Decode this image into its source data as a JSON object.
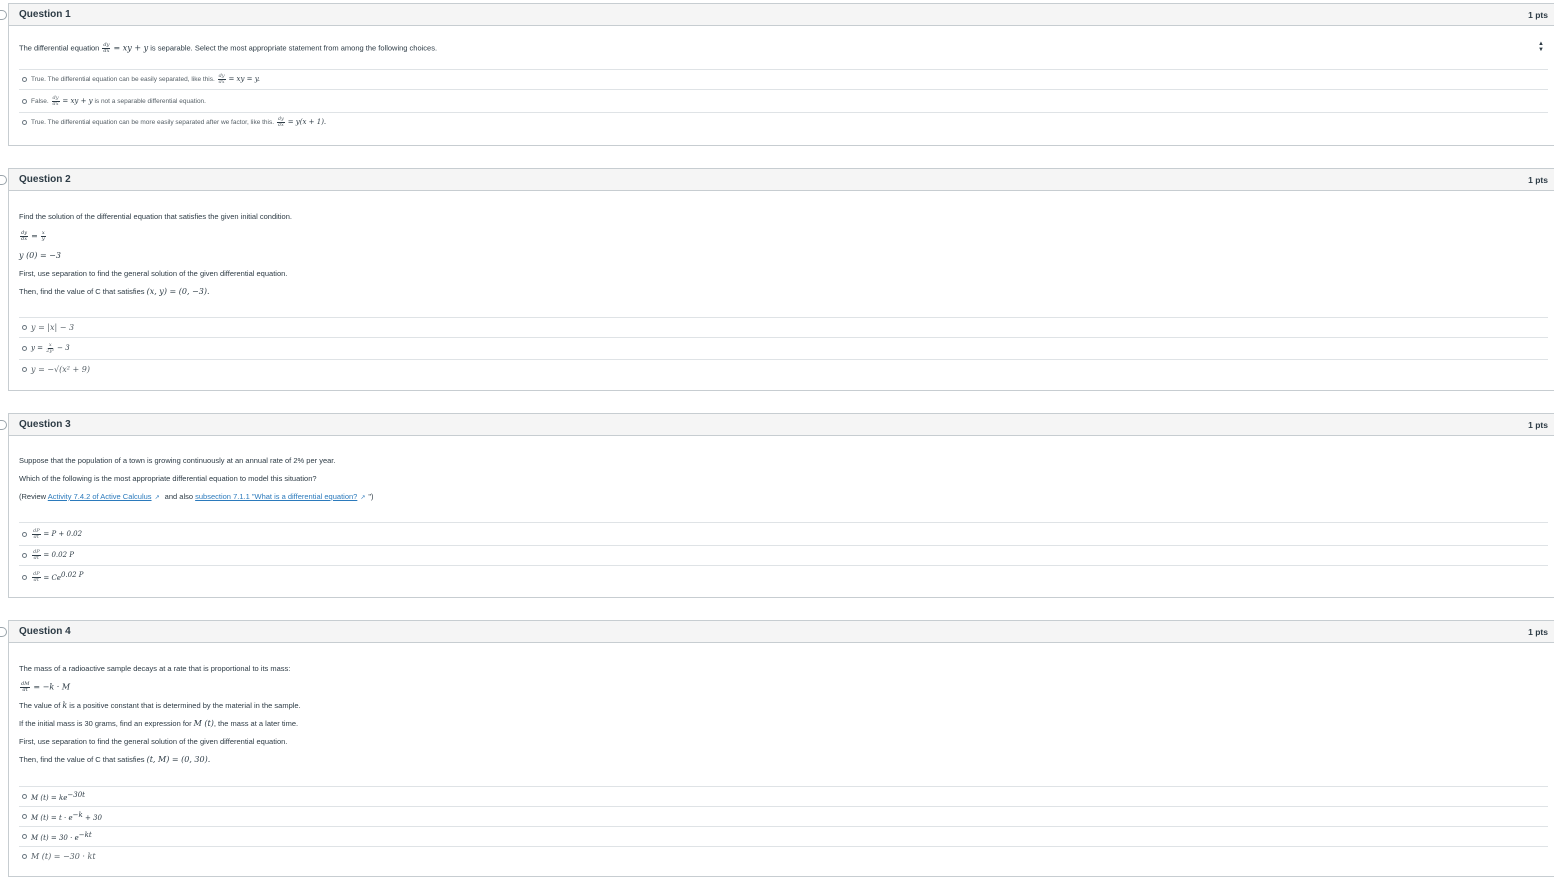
{
  "questions": [
    {
      "title": "Question 1",
      "points": "1 pts",
      "text_before": "The differential equation ",
      "eq_num": "dy",
      "eq_den": "dx",
      "eq_rhs": "= xy + y",
      "text_after": " is separable. Select the most appropriate statement from among the following choices.",
      "answers": [
        {
          "prefix": "True. The differential equation can be easily separated, like this. ",
          "num": "dy",
          "den": "dx",
          "math": "= xy = y."
        },
        {
          "prefix": "False. ",
          "num": "dy",
          "den": "dx",
          "math": "= xy + y",
          "suffix": " is not a separable differential equation."
        },
        {
          "prefix": "True. The differential equation can be more easily separated after we factor, like this. ",
          "num": "dy",
          "den": "dx",
          "math": "= y(x + 1)."
        }
      ]
    },
    {
      "title": "Question 2",
      "points": "1 pts",
      "line1": "Find the solution of the differential equation that satisfies the given initial condition.",
      "eq_num": "dy",
      "eq_den": "dx",
      "eq_rhs": "=",
      "eq_rhs_num": "x",
      "eq_rhs_den": "y",
      "initial": "y (0) = −3",
      "line3": "First, use separation to find the general solution of the given differential equation.",
      "line4_before": "Then, find the value of C that satisfies ",
      "line4_math": "(x, y) = (0, −3).",
      "answers": [
        {
          "math": "y = |x| − 3"
        },
        {
          "math_pre": "y = ",
          "num": "x",
          "den": "2y²",
          "math": "− 3"
        },
        {
          "math": "y = −√(x² + 9)"
        }
      ]
    },
    {
      "title": "Question 3",
      "points": "1 pts",
      "line1": "Suppose that the population of a town is growing continuously at an annual rate of 2% per year.",
      "line2": "Which of the following is the most appropriate differential equation to model this situation?",
      "review_prefix": "(Review ",
      "link1": "Activity 7.4.2 of Active Calculus",
      "review_mid": " and also ",
      "link2": "subsection 7.1.1 \"What is a differential equation?",
      "review_end": "\")",
      "ext_icon": "↗",
      "answers": [
        {
          "num": "dP",
          "den": "dt",
          "math": "= P + 0.02"
        },
        {
          "num": "dP",
          "den": "dt",
          "math": "= 0.02 P"
        },
        {
          "num": "dP",
          "den": "dt",
          "math": "= Ce",
          "sup": "0.02 P"
        }
      ]
    },
    {
      "title": "Question 4",
      "points": "1 pts",
      "line1": "The mass of a radioactive sample decays at a rate that is proportional to its mass:",
      "eq_num": "dM",
      "eq_den": "dt",
      "eq_rhs": "= −k · M",
      "line3_before": "The value of ",
      "line3_math": "k",
      "line3_after": " is a positive constant that is determined by the material in the sample.",
      "line4_before": "If the initial mass is 30 grams, find an expression for ",
      "line4_math": "M (t)",
      "line4_after": ", the mass at a later time.",
      "line5": "First, use separation to find the general solution of the given differential equation.",
      "line6_before": "Then, find the value of C that satisfies ",
      "line6_math": "(t, M) = (0, 30).",
      "answers": [
        {
          "math": "M (t) = ke",
          "sup": "−30t"
        },
        {
          "math": "M (t) = t · e",
          "sup": "−k",
          "math2": " + 30"
        },
        {
          "math": "M (t) = 30 · e",
          "sup": "−kt"
        },
        {
          "math": "M (t) = −30 · kt"
        }
      ]
    }
  ]
}
